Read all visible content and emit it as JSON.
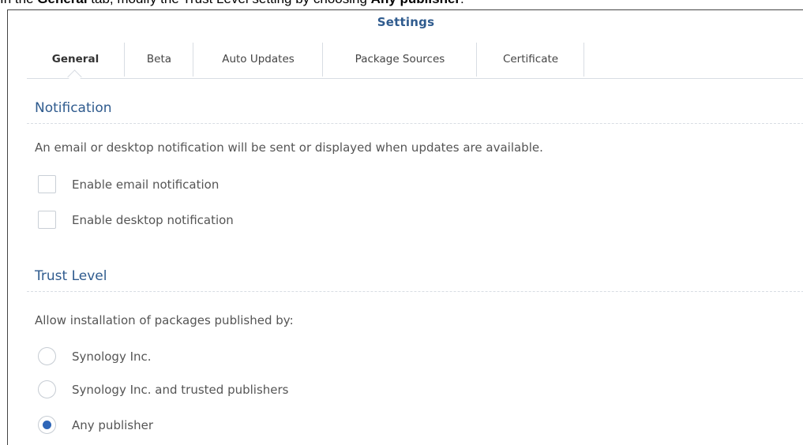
{
  "instruction": {
    "prefix": "In the ",
    "tab_name": "General",
    "middle": " tab, modify the Trust Level setting by choosing ",
    "option_name": "Any publisher",
    "suffix": "."
  },
  "window": {
    "title": "Settings"
  },
  "tabs": [
    {
      "label": "General",
      "active": true
    },
    {
      "label": "Beta",
      "active": false
    },
    {
      "label": "Auto Updates",
      "active": false
    },
    {
      "label": "Package Sources",
      "active": false
    },
    {
      "label": "Certificate",
      "active": false
    }
  ],
  "notification": {
    "title": "Notification",
    "description": "An email or desktop notification will be sent or displayed when updates are available.",
    "options": [
      {
        "label": "Enable email notification",
        "checked": false
      },
      {
        "label": "Enable desktop notification",
        "checked": false
      }
    ]
  },
  "trust_level": {
    "title": "Trust Level",
    "description": "Allow installation of packages published by:",
    "options": [
      {
        "label": "Synology Inc.",
        "selected": false
      },
      {
        "label": "Synology Inc. and trusted publishers",
        "selected": false
      },
      {
        "label": "Any publisher",
        "selected": true
      }
    ]
  },
  "colors": {
    "accent": "#2f5b8e",
    "radio_selected": "#2e66b8"
  }
}
